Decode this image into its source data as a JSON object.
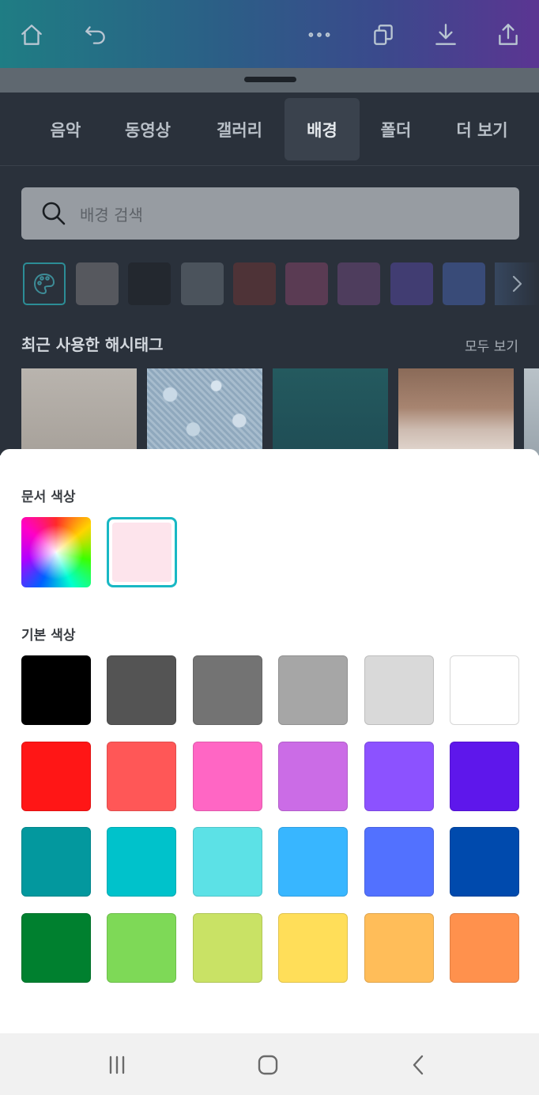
{
  "toolbar": {
    "icons": [
      "home-icon",
      "undo-icon",
      "more-icon",
      "pages-icon",
      "download-icon",
      "share-icon"
    ],
    "gradient": [
      "#1f7d84",
      "#5b3592"
    ]
  },
  "tabs": [
    {
      "label": "음악"
    },
    {
      "label": "동영상"
    },
    {
      "label": "갤러리"
    },
    {
      "label": "배경"
    },
    {
      "label": "폴더"
    },
    {
      "label": "더 보기"
    }
  ],
  "active_tab": "배경",
  "search": {
    "placeholder": "배경 검색"
  },
  "color_filters": [
    "#56585e",
    "#23282f",
    "#4b535c",
    "#4e3337",
    "#5a3b53",
    "#4e3d5d",
    "#413d72",
    "#394b78"
  ],
  "hashtags": {
    "title": "최근 사용한 해시태그",
    "see_all": "모두 보기"
  },
  "sheet": {
    "doc_colors_label": "문서 색상",
    "doc_color": "#fde4ec",
    "basic_colors_label": "기본 색상",
    "basic_colors": [
      [
        "#000000",
        "#545454",
        "#737373",
        "#a6a6a6",
        "#d9d9d9",
        "#ffffff"
      ],
      [
        "#ff1616",
        "#ff5757",
        "#ff66c4",
        "#cb6ce6",
        "#8c52ff",
        "#5e17eb"
      ],
      [
        "#03989e",
        "#00c2cb",
        "#5ce1e6",
        "#38b6ff",
        "#5271ff",
        "#004aad"
      ],
      [
        "#00802f",
        "#7ed957",
        "#c9e265",
        "#ffde59",
        "#ffbd59",
        "#ff914d"
      ]
    ]
  },
  "navbar": {
    "icons": [
      "recent-apps-icon",
      "home-nav-icon",
      "back-icon"
    ]
  }
}
